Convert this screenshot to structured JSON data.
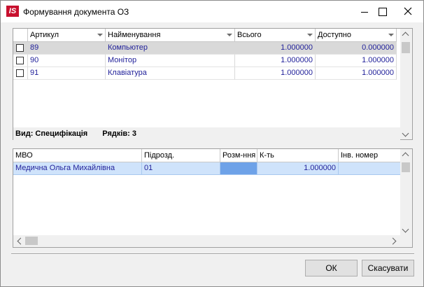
{
  "window": {
    "title": "Формування документа ОЗ",
    "app_icon_text": "IS"
  },
  "top_grid": {
    "columns": [
      "Артикул",
      "Найменування",
      "Всього",
      "Доступно"
    ],
    "rows": [
      {
        "checked": false,
        "code": "89",
        "name": "Компьютер",
        "total": "1.000000",
        "available": "0.000000"
      },
      {
        "checked": false,
        "code": "90",
        "name": "Монітор",
        "total": "1.000000",
        "available": "1.000000"
      },
      {
        "checked": false,
        "code": "91",
        "name": "Клавіатура",
        "total": "1.000000",
        "available": "1.000000"
      }
    ],
    "footer": {
      "view": "Вид: Специфікація",
      "rows_count": "Рядків: 3"
    }
  },
  "bottom_grid": {
    "columns": [
      "МВО",
      "Підрозд.",
      "Розм-ння",
      "К-ть",
      "Інв. номер"
    ],
    "rows": [
      {
        "mvo": "Медична Ольга Михайлівна",
        "dept": "01",
        "placement": "",
        "qty": "1.000000",
        "inv": ""
      }
    ]
  },
  "buttons": {
    "ok": "ОК",
    "cancel": "Скасувати"
  },
  "colors": {
    "link_text": "#1f1f99",
    "selection": "#cfe3fb",
    "focus_cell": "#6ea2e8",
    "brand": "#c8102e"
  }
}
